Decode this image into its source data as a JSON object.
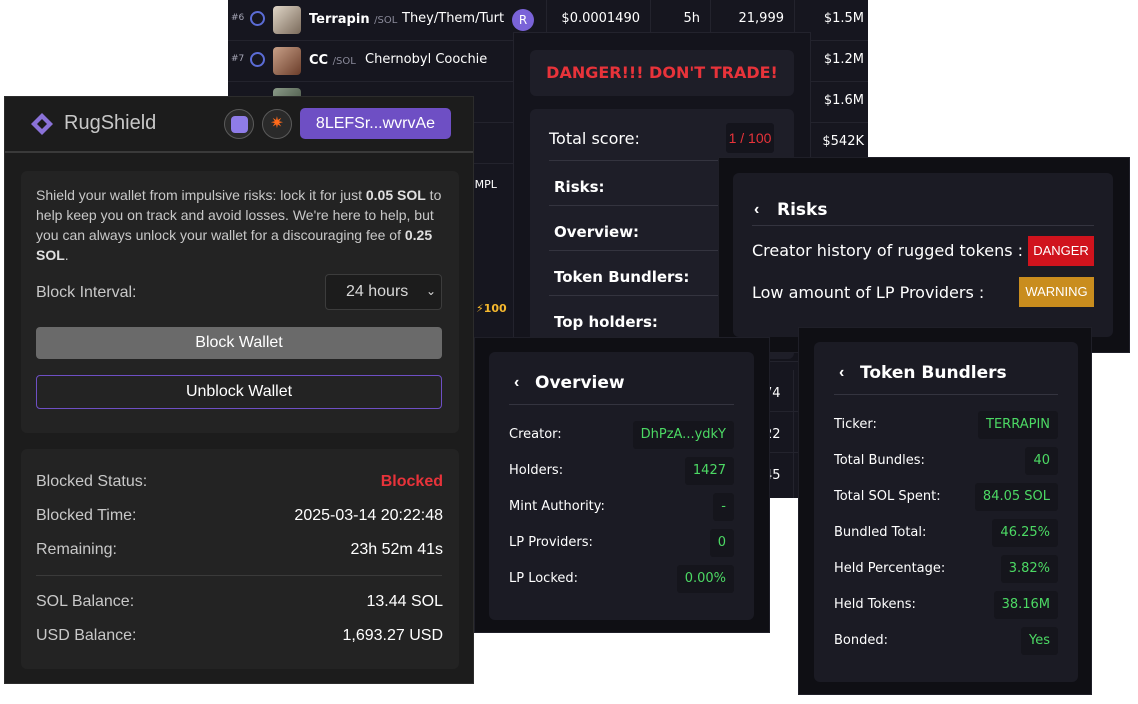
{
  "table": {
    "rows": [
      {
        "rank": "#6",
        "symbol": "Terrapin",
        "chain": "/SOL",
        "name": "They/Them/Turt",
        "badge": "R",
        "price": "$0.0001490",
        "age": "5h",
        "txns": "21,999",
        "mcap": "$1.5M"
      },
      {
        "rank": "#7",
        "symbol": "CC",
        "chain": "/SOL",
        "name": "Chernobyl Coochie",
        "mcap": "$1.2M"
      },
      {
        "mcap": "$1.6M"
      },
      {
        "mcap": "$542K"
      }
    ],
    "partial": {
      "ompl": "OMPL",
      "score": "100",
      "v1": "74",
      "v2": "22",
      "v3": "45"
    }
  },
  "rugshield": {
    "title": "RugShield",
    "wallet_address": "8LEFSr...wvrvAe",
    "description_parts": [
      "Shield your wallet from impulsive risks: lock it for just ",
      "0.05 SOL",
      " to help keep you on track and avoid losses. We're here to help, but you can always unlock your wallet for a discouraging fee of ",
      "0.25 SOL",
      "."
    ],
    "block_interval_label": "Block Interval:",
    "block_interval_value": "24 hours",
    "block_button": "Block Wallet",
    "unblock_button": "Unblock Wallet",
    "status": [
      {
        "label": "Blocked Status:",
        "value": "Blocked"
      },
      {
        "label": "Blocked Time:",
        "value": "2025-03-14 20:22:48"
      },
      {
        "label": "Remaining:",
        "value": "23h 52m 41s"
      }
    ],
    "balances": [
      {
        "label": "SOL Balance:",
        "value": "13.44 SOL"
      },
      {
        "label": "USD Balance:",
        "value": "1,693.27 USD"
      }
    ]
  },
  "danger": {
    "banner": "DANGER!!! DON'T TRADE!",
    "total_score_label": "Total score:",
    "total_score_value": "1 / 100",
    "sections": [
      "Risks:",
      "Overview:",
      "Token Bundlers:",
      "Top holders:"
    ]
  },
  "risks": {
    "title": "Risks",
    "items": [
      {
        "label": "Creator history of rugged tokens :",
        "badge": "DANGER",
        "color": "#d0131d"
      },
      {
        "label": "Low amount of LP Providers :",
        "badge": "WARNING",
        "color": "#c98d1e"
      }
    ]
  },
  "overview": {
    "title": "Overview",
    "rows": [
      {
        "label": "Creator:",
        "value": "DhPzA...ydkY"
      },
      {
        "label": "Holders:",
        "value": "1427"
      },
      {
        "label": "Mint Authority:",
        "value": "-"
      },
      {
        "label": "LP Providers:",
        "value": "0"
      },
      {
        "label": "LP Locked:",
        "value": "0.00%"
      }
    ]
  },
  "bundlers": {
    "title": "Token Bundlers",
    "rows": [
      {
        "label": "Ticker:",
        "value": "TERRAPIN"
      },
      {
        "label": "Total Bundles:",
        "value": "40"
      },
      {
        "label": "Total SOL Spent:",
        "value": "84.05 SOL"
      },
      {
        "label": "Bundled Total:",
        "value": "46.25%"
      },
      {
        "label": "Held Percentage:",
        "value": "3.82%"
      },
      {
        "label": "Held Tokens:",
        "value": "38.16M"
      },
      {
        "label": "Bonded:",
        "value": "Yes"
      }
    ]
  },
  "colors": {
    "accent": "#6e4fc4",
    "danger_text": "#e8333a",
    "positive": "#4cd964",
    "blocked": "#e8333a"
  }
}
